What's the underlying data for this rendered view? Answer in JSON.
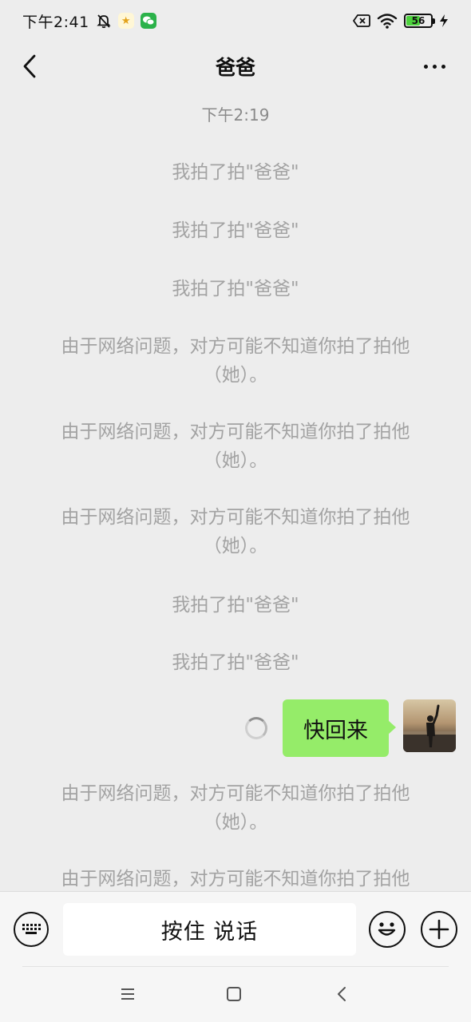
{
  "status_bar": {
    "time": "下午2:41",
    "battery_level": "56",
    "battery_fraction": 0.56,
    "icons": [
      "bell-off-icon",
      "gift-app-icon",
      "wechat-icon",
      "sim-x-icon",
      "wifi-icon",
      "battery-icon",
      "charging-icon"
    ]
  },
  "header": {
    "title": "爸爸",
    "back_icon": "back-chevron-icon",
    "more_icon": "more-dots-icon"
  },
  "chat": {
    "timestamp": "下午2:19",
    "messages": [
      {
        "type": "system",
        "text": "我拍了拍\"爸爸\""
      },
      {
        "type": "system",
        "text": "我拍了拍\"爸爸\""
      },
      {
        "type": "system",
        "text": "我拍了拍\"爸爸\""
      },
      {
        "type": "system",
        "text": "由于网络问题，对方可能不知道你拍了拍他（她）。"
      },
      {
        "type": "system",
        "text": "由于网络问题，对方可能不知道你拍了拍他（她）。"
      },
      {
        "type": "system",
        "text": "由于网络问题，对方可能不知道你拍了拍他（她）。"
      },
      {
        "type": "system",
        "text": "我拍了拍\"爸爸\""
      },
      {
        "type": "system",
        "text": "我拍了拍\"爸爸\""
      },
      {
        "type": "sent",
        "text": "快回来",
        "status": "sending"
      },
      {
        "type": "system",
        "text": "由于网络问题，对方可能不知道你拍了拍他（她）。"
      },
      {
        "type": "system",
        "text": "由于网络问题，对方可能不知道你拍了拍他"
      }
    ]
  },
  "input_bar": {
    "hold_to_talk_label": "按住 说话",
    "keyboard_icon": "keyboard-icon",
    "emoji_icon": "emoji-icon",
    "plus_icon": "plus-icon"
  },
  "nav_bar": {
    "icons": [
      "menu-icon",
      "home-square-icon",
      "back-triangle-icon"
    ]
  },
  "colors": {
    "background": "#ededed",
    "sent_bubble": "#95ec69",
    "system_text": "#a3a3a3"
  }
}
